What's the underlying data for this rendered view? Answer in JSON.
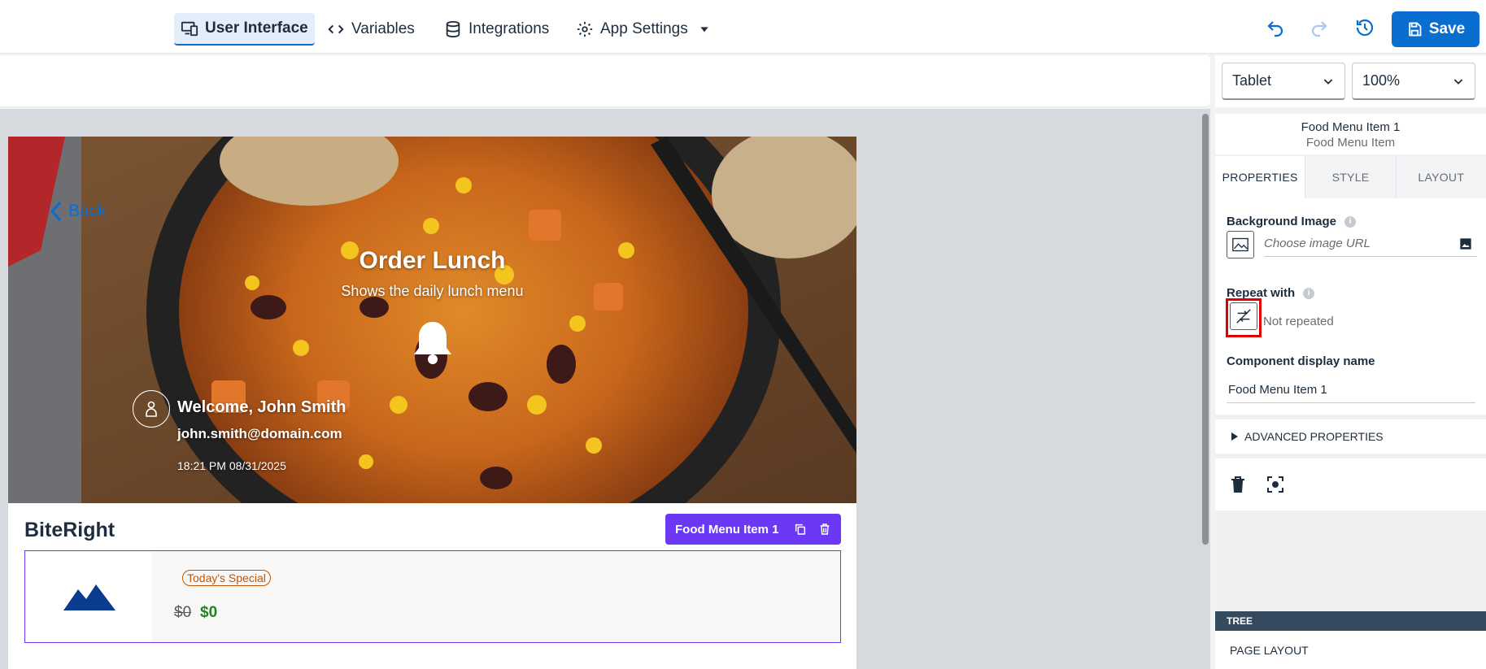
{
  "topbar": {
    "tabs": [
      {
        "label": "User Interface",
        "icon": "devices-icon",
        "active": true
      },
      {
        "label": "Variables",
        "icon": "code-icon"
      },
      {
        "label": "Integrations",
        "icon": "database-icon"
      },
      {
        "label": "App Settings",
        "icon": "gear-icon"
      }
    ],
    "save_label": "Save",
    "accent": "#0a6ed1"
  },
  "device": {
    "selected": "Tablet"
  },
  "zoom": {
    "selected": "100%"
  },
  "preview": {
    "back_label": "Back",
    "title": "Order Lunch",
    "subtitle": "Shows the daily lunch menu",
    "welcome": "Welcome, John Smith",
    "email": "john.smith@domain.com",
    "timestamp": "18:21 PM 08/31/2025",
    "brand": "BiteRight",
    "selected_component": "Food Menu Item 1",
    "card": {
      "badge": "Today's Special",
      "price_old": "$0",
      "price_new": "$0"
    }
  },
  "panel": {
    "component_name": "Food Menu Item 1",
    "component_type": "Food Menu Item",
    "tabs": [
      "PROPERTIES",
      "STYLE",
      "LAYOUT"
    ],
    "background_image_label": "Background Image",
    "image_url_placeholder": "Choose image URL",
    "repeat_with_label": "Repeat with",
    "repeat_value": "Not repeated",
    "display_name_label": "Component display name",
    "display_name_value": "Food Menu Item 1",
    "advanced_label": "ADVANCED PROPERTIES",
    "tree_label": "TREE",
    "tree_item": "PAGE LAYOUT"
  }
}
